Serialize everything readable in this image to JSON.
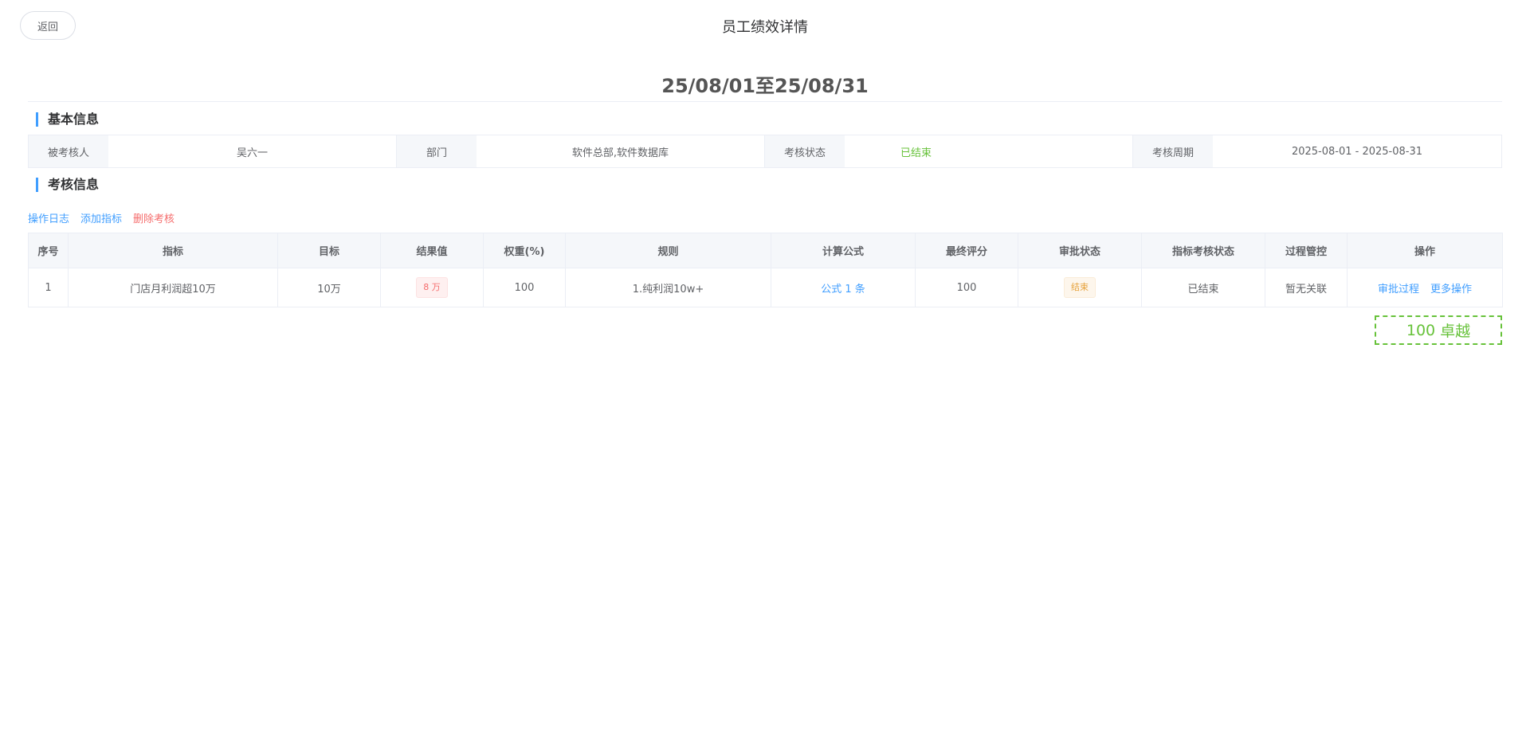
{
  "header": {
    "back_label": "返回",
    "title": "员工绩效详情"
  },
  "period": "25/08/01至25/08/31",
  "basic_info": {
    "section_title": "基本信息",
    "fields": [
      {
        "label": "被考核人",
        "value": "吴六一"
      },
      {
        "label": "部门",
        "value": "软件总部,软件数据库"
      },
      {
        "label": "考核状态",
        "value": "已结束"
      },
      {
        "label": "考核周期",
        "value": "2025-08-01 - 2025-08-31"
      }
    ]
  },
  "assessment": {
    "section_title": "考核信息",
    "actions": {
      "log": "操作日志",
      "add": "添加指标",
      "delete": "删除考核"
    },
    "columns": [
      "序号",
      "指标",
      "目标",
      "结果值",
      "权重(%)",
      "规则",
      "计算公式",
      "最终评分",
      "审批状态",
      "指标考核状态",
      "过程管控",
      "操作"
    ],
    "rows": [
      {
        "index": "1",
        "indicator": "门店月利润超10万",
        "target": "10万",
        "result": "8 万",
        "weight": "100",
        "rule": "1.纯利润10w+",
        "formula": "公式 1 条",
        "final_score": "100",
        "approval_status": "结束",
        "indicator_status": "已结束",
        "process_control": "暂无关联",
        "op_approval": "审批过程",
        "op_more": "更多操作"
      }
    ]
  },
  "score": {
    "value": "100",
    "grade": "卓越"
  },
  "colors": {
    "primary": "#409eff",
    "success": "#67c23a",
    "danger": "#f56c6c",
    "warning": "#e6a23c"
  }
}
